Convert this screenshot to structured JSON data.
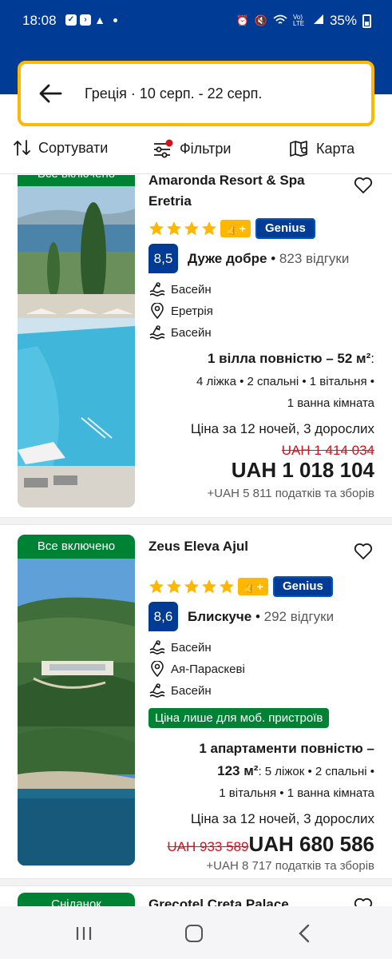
{
  "status_bar": {
    "time": "18:08",
    "battery": "35%",
    "network": "Vo) LTE"
  },
  "search": {
    "query": "Греція · 10 серп. - 22 серп."
  },
  "toolbar": {
    "sort_label": "Сортувати",
    "filters_label": "Фільтри",
    "map_label": "Карта"
  },
  "colors": {
    "brand_blue": "#003b95",
    "search_border": "#ffb700",
    "green_badge": "#008234",
    "price_strike": "#d4111e"
  },
  "hotels": [
    {
      "badge": "Все включено",
      "name_line1": "Amaronda Resort & Spa",
      "name_line2": "Eretria",
      "stars": 4,
      "genius": "Genius",
      "score": "8,5",
      "rating_word": "Дуже добре",
      "reviews": "823 відгуки",
      "features": [
        "Басейн",
        "Еретрія",
        "Басейн"
      ],
      "feature_icons": [
        "pool-icon",
        "location-pin-icon",
        "pool-icon"
      ],
      "room_title": "1 вілла повністю – 52 м²",
      "room_colon": ":",
      "room_details_1": "4 ліжка • 2 спальні • 1 вітальня •",
      "room_details_2": "1 ванна кімната",
      "price_for": "Ціна за 12 ночей, 3 дорослих",
      "old_price": "UAH 1 414 034",
      "price": "UAH 1 018 104",
      "taxes": "+UAH 5 811 податків та зборів"
    },
    {
      "badge": "Все включено",
      "name_line1": "Zeus Eleva Ajul",
      "stars": 5,
      "genius": "Genius",
      "score": "8,6",
      "rating_word": "Блискуче",
      "reviews": "292 відгуки",
      "features": [
        "Басейн",
        "Ая-Параскеві",
        "Басейн"
      ],
      "feature_icons": [
        "pool-icon",
        "location-pin-icon",
        "pool-icon"
      ],
      "mobile_badge": "Ціна лише для моб. пристроїв",
      "room_title_1": "1 апартаменти повністю –",
      "room_title_2": "123 м²",
      "room_details_1": ": 5 ліжок • 2 спальні •",
      "room_details_2": "1 вітальня • 1 ванна кімната",
      "price_for": "Ціна за 12 ночей, 3 дорослих",
      "old_price": "UAH 933 589",
      "price": "UAH 680 586",
      "taxes": "+UAH 8 717 податків та зборів"
    },
    {
      "badge": "Сніданок",
      "name_line1": "Grecotel Creta Palace"
    }
  ]
}
